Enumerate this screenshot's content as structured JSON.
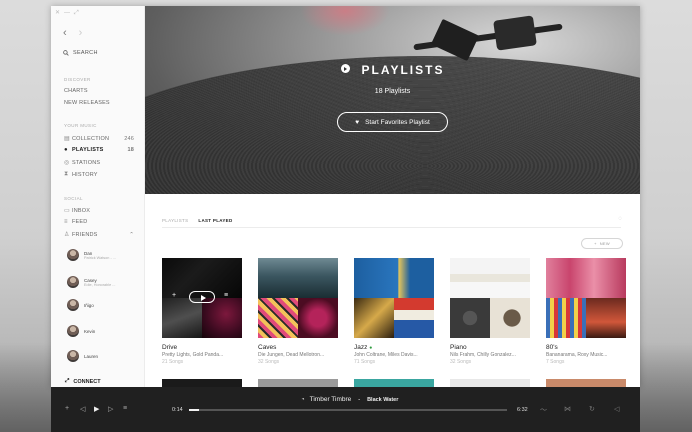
{
  "sidebar": {
    "search_label": "SEARCH",
    "discover_title": "DISCOVER",
    "discover_items": [
      {
        "label": "CHARTS"
      },
      {
        "label": "NEW RELEASES"
      }
    ],
    "your_music_title": "YOUR MUSIC",
    "your_music_items": [
      {
        "label": "COLLECTION",
        "count": "246"
      },
      {
        "label": "PLAYLISTS",
        "count": "18"
      },
      {
        "label": "STATIONS",
        "count": ""
      },
      {
        "label": "HISTORY",
        "count": ""
      }
    ],
    "social_title": "SOCIAL",
    "social_items": [
      {
        "label": "INBOX"
      },
      {
        "label": "FEED"
      },
      {
        "label": "FRIENDS"
      }
    ],
    "friends": [
      {
        "name": "Dan",
        "sub": "Patrick Watson - ..."
      },
      {
        "name": "Casey",
        "sub": "Edie, Honorable ..."
      },
      {
        "name": "Iñigo",
        "sub": ""
      },
      {
        "name": "Kevin",
        "sub": ""
      },
      {
        "name": "Lauren",
        "sub": ""
      }
    ],
    "connect_label": "CONNECT"
  },
  "hero": {
    "title": "PLAYLISTS",
    "subtitle": "18 Playlists",
    "button_label": "Start Favorites Playlist"
  },
  "content": {
    "tabs": [
      {
        "label": "PLAYLISTS"
      },
      {
        "label": "LAST PLAYED"
      }
    ],
    "new_label": "NEW",
    "playlists": [
      {
        "name": "Drive",
        "artists": "Pretty Lights, Gold Panda...",
        "songs": "21 Songs"
      },
      {
        "name": "Caves",
        "artists": "Die Jungen, Dead Mellotron...",
        "songs": "32 Songs"
      },
      {
        "name": "Jazz",
        "artists": "John Coltrane, Miles Davis...",
        "songs": "71 Songs"
      },
      {
        "name": "Piano",
        "artists": "Nils Frahm, Chilly Gonzalez...",
        "songs": "32 Songs"
      },
      {
        "name": "80's",
        "artists": "Bananarama, Roxy Music...",
        "songs": "7 Songs"
      }
    ]
  },
  "player": {
    "track_artist": "Timber Timbre",
    "track_sep": " - ",
    "track_title": "Black Water",
    "elapsed": "0:14",
    "duration": "6:32",
    "progress_fraction": 0.03
  },
  "colors": {
    "accent": "#222222",
    "player_bg": "#202020"
  }
}
